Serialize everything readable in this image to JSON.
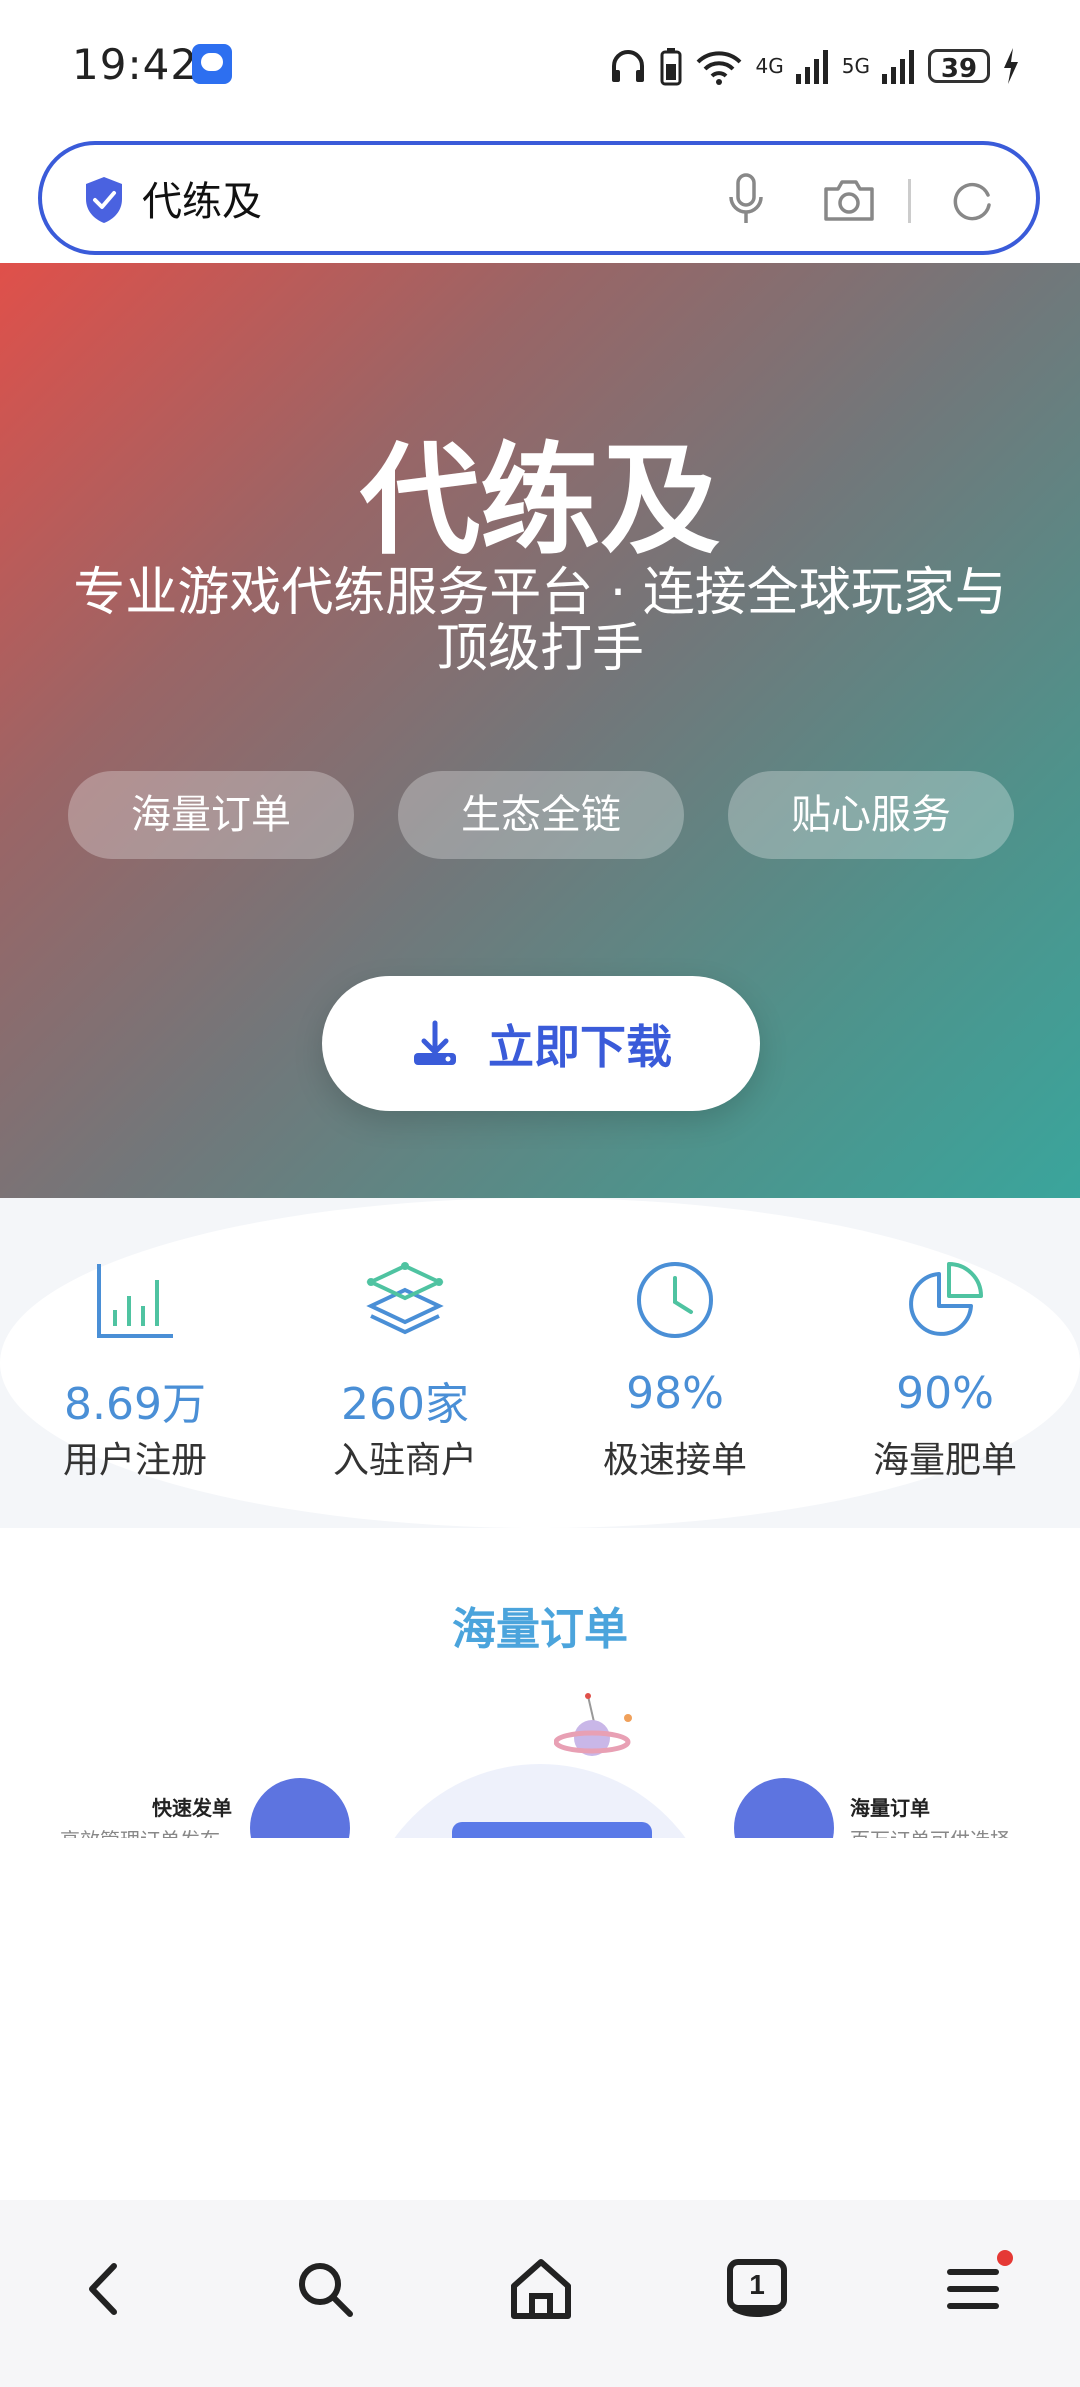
{
  "status_bar": {
    "time": "19:42",
    "battery": "39",
    "network_labels": [
      "4G",
      "5G"
    ],
    "icons": [
      "headphones-icon",
      "wifi-icon",
      "signal-icon",
      "charging-icon"
    ]
  },
  "search": {
    "query": "代练及",
    "icons": [
      "shield-icon",
      "mic-icon",
      "camera-icon",
      "refresh-icon"
    ],
    "border_color": "#3a5bd9"
  },
  "hero": {
    "title": "代练及",
    "subtitle": "专业游戏代练服务平台 · 连接全球玩家与顶级打手",
    "tags": [
      "海量订单",
      "生态全链",
      "贴心服务"
    ],
    "download_label": "立即下载",
    "gradient_colors": [
      "#e0504a",
      "#72777a",
      "#3aa59c"
    ]
  },
  "stats": [
    {
      "icon": "bar-chart-icon",
      "value": "8.69万",
      "label": "用户注册"
    },
    {
      "icon": "layers-icon",
      "value": "260家",
      "label": "入驻商户"
    },
    {
      "icon": "clock-icon",
      "value": "98%",
      "label": "极速接单"
    },
    {
      "icon": "pie-chart-icon",
      "value": "90%",
      "label": "海量肥单"
    }
  ],
  "section": {
    "title": "海量订单",
    "features": [
      {
        "title": "快速发单",
        "desc": "高效管理订单发布"
      },
      {
        "title": "海量订单",
        "desc": "百万订单可供选择"
      }
    ]
  },
  "bottom_nav": {
    "items": [
      "back-icon",
      "search-icon",
      "home-icon",
      "tabs-icon",
      "menu-icon"
    ],
    "tab_count": "1"
  },
  "colors": {
    "accent": "#3a5bd9",
    "stat_value": "#4a8fd6",
    "section_title": "#4ba4dc",
    "notification": "#e53935"
  }
}
